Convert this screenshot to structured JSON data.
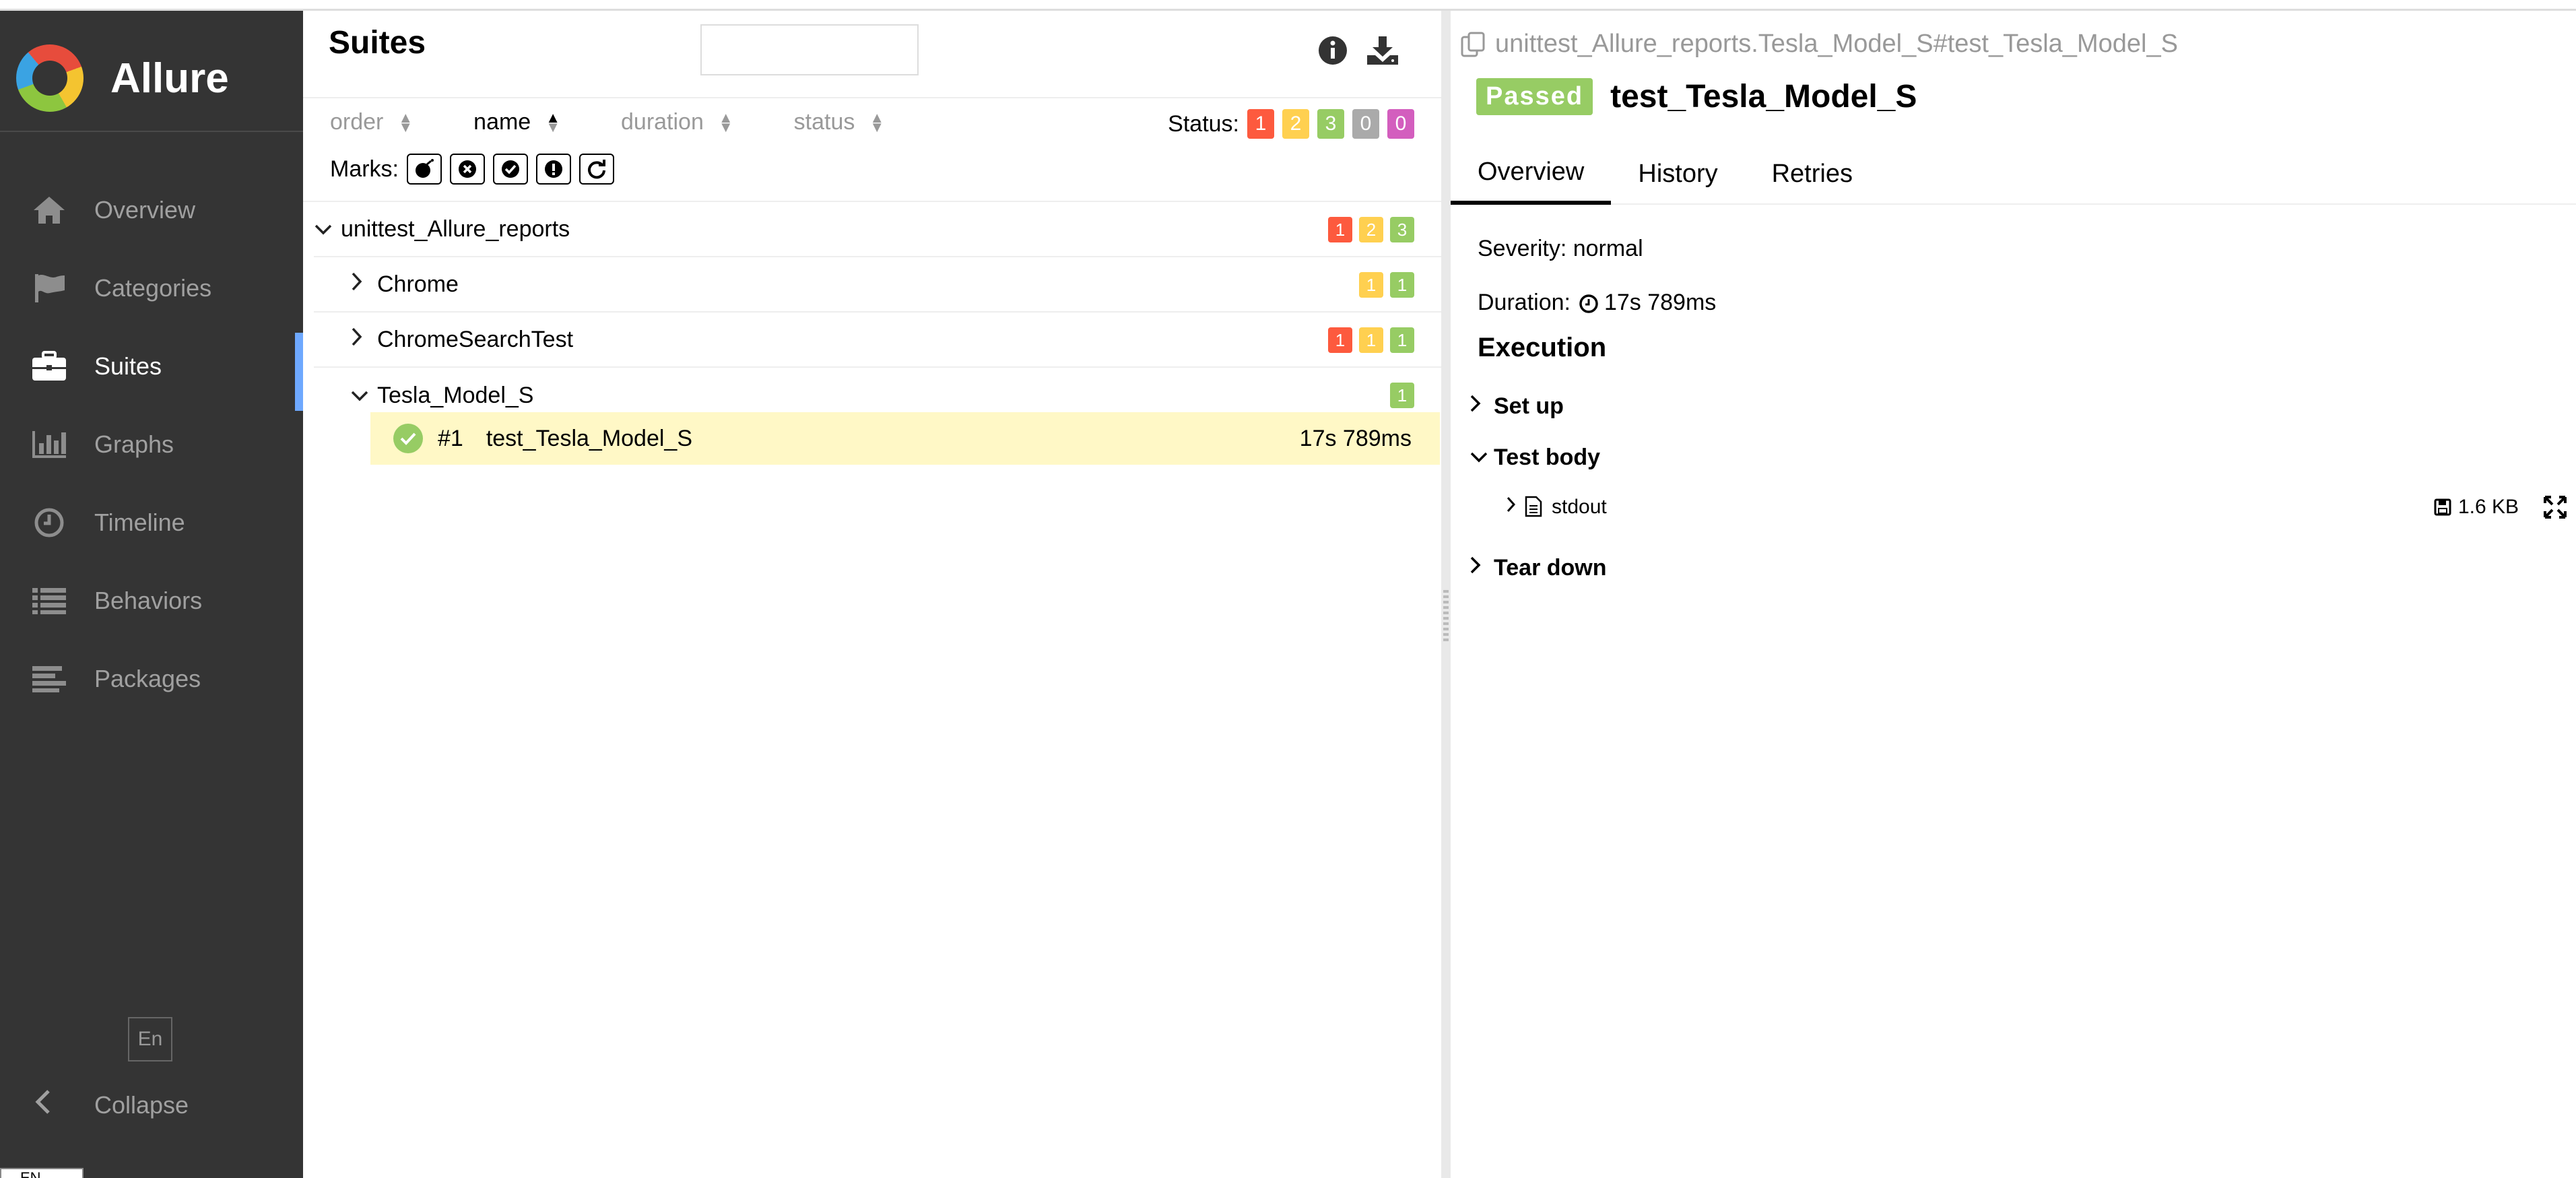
{
  "app": {
    "name": "Allure"
  },
  "sidebar": {
    "items": [
      {
        "key": "overview",
        "label": "Overview",
        "icon": "home-icon",
        "active": false
      },
      {
        "key": "categories",
        "label": "Categories",
        "icon": "flag-icon",
        "active": false
      },
      {
        "key": "suites",
        "label": "Suites",
        "icon": "briefcase-icon",
        "active": true
      },
      {
        "key": "graphs",
        "label": "Graphs",
        "icon": "bar-chart-icon",
        "active": false
      },
      {
        "key": "timeline",
        "label": "Timeline",
        "icon": "clock-icon",
        "active": false
      },
      {
        "key": "behaviors",
        "label": "Behaviors",
        "icon": "list-icon",
        "active": false
      },
      {
        "key": "packages",
        "label": "Packages",
        "icon": "align-left-icon",
        "active": false
      }
    ],
    "language_button": "En",
    "collapse_label": "Collapse",
    "locale_chip": "EN"
  },
  "suites_pane": {
    "title": "Suites",
    "search": {
      "value": "",
      "placeholder": ""
    },
    "sort": [
      {
        "label": "order",
        "active": false
      },
      {
        "label": "name",
        "active": true
      },
      {
        "label": "duration",
        "active": false
      },
      {
        "label": "status",
        "active": false
      }
    ],
    "status_label": "Status:",
    "status_counts": {
      "failed": "1",
      "broken": "2",
      "passed": "3",
      "skipped": "0",
      "unknown": "0"
    },
    "marks_label": "Marks:",
    "marks": [
      "flaky-bomb-icon",
      "new-failed-icon",
      "new-passed-icon",
      "new-broken-icon",
      "retries-icon"
    ],
    "tree": {
      "root": {
        "name": "unittest_Allure_reports",
        "counts": {
          "failed": "1",
          "broken": "2",
          "passed": "3"
        }
      },
      "children": [
        {
          "name": "Chrome",
          "expanded": false,
          "counts": {
            "broken": "1",
            "passed": "1"
          }
        },
        {
          "name": "ChromeSearchTest",
          "expanded": false,
          "counts": {
            "failed": "1",
            "broken": "1",
            "passed": "1"
          }
        },
        {
          "name": "Tesla_Model_S",
          "expanded": true,
          "counts": {
            "passed": "1"
          }
        }
      ],
      "selected_test": {
        "number": "#1",
        "name": "test_Tesla_Model_S",
        "duration": "17s 789ms",
        "status": "passed"
      }
    }
  },
  "test_pane": {
    "path": "unittest_Allure_reports.Tesla_Model_S#test_Tesla_Model_S",
    "status_badge": "Passed",
    "title": "test_Tesla_Model_S",
    "tabs": [
      {
        "label": "Overview",
        "active": true
      },
      {
        "label": "History",
        "active": false
      },
      {
        "label": "Retries",
        "active": false
      }
    ],
    "severity": "Severity: normal",
    "duration_label": "Duration:",
    "duration_value": "17s 789ms",
    "execution_title": "Execution",
    "sections": {
      "setup": "Set up",
      "test_body": "Test body",
      "teardown": "Tear down"
    },
    "attachment": {
      "name": "stdout",
      "size": "1.6 KB"
    }
  },
  "colors": {
    "sidebar_bg": "#343434",
    "failed": "#fd5a3e",
    "broken": "#ffd050",
    "passed": "#97cc64",
    "skipped": "#aaaaaa",
    "unknown": "#d35ebe",
    "selected_row": "#fff8c6",
    "active_indicator": "#6ea8fe"
  }
}
